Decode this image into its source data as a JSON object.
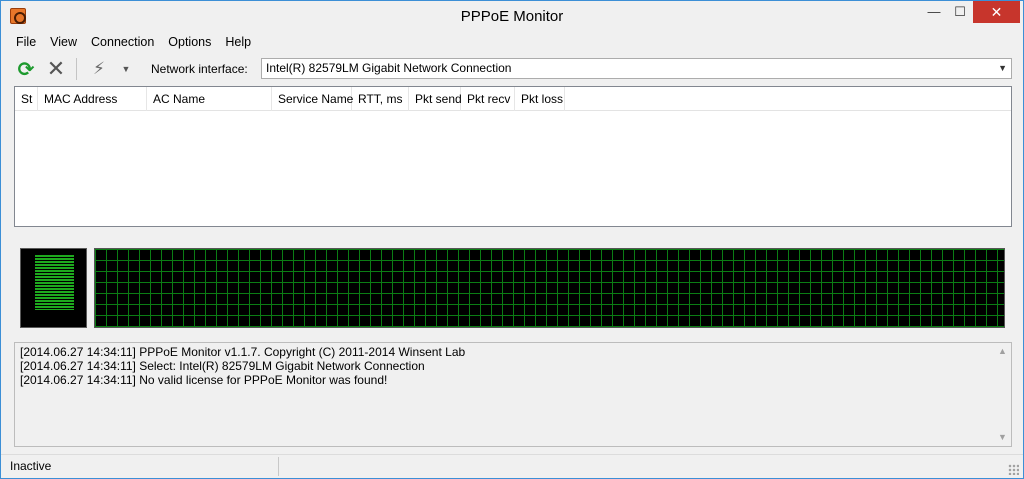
{
  "window": {
    "title": "PPPoE Monitor",
    "minimize": "—",
    "maximize": "☐",
    "close": "✕"
  },
  "menu": [
    "File",
    "View",
    "Connection",
    "Options",
    "Help"
  ],
  "toolbar": {
    "network_label": "Network interface:",
    "network_value": "Intel(R) 82579LM Gigabit Network Connection"
  },
  "columns": [
    "St",
    "MAC Address",
    "AC Name",
    "Service Name",
    "RTT, ms",
    "Pkt send",
    "Pkt recv",
    "Pkt loss"
  ],
  "log": [
    "[2014.06.27 14:34:11] PPPoE Monitor v1.1.7. Copyright (C) 2011-2014 Winsent Lab",
    "[2014.06.27 14:34:11] Select: Intel(R) 82579LM Gigabit Network Connection",
    "[2014.06.27 14:34:11] No valid license for PPPoE Monitor was found!"
  ],
  "status": "Inactive",
  "colors": {
    "graph_grid": "#0b7d14",
    "meter_bar": "#1ea91e",
    "close_button": "#c7352c"
  }
}
